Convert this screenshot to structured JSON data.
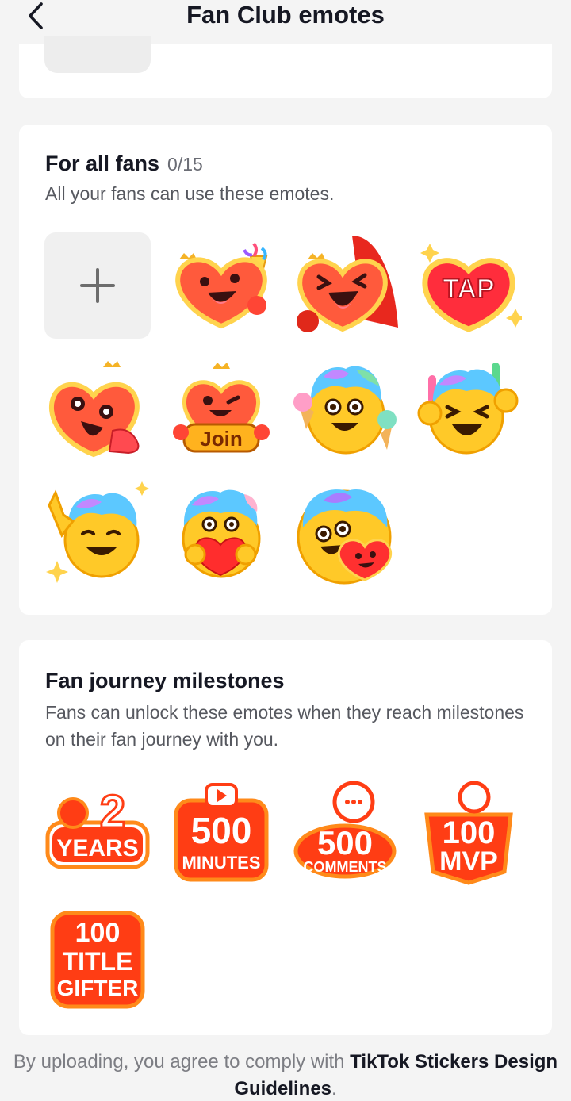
{
  "header": {
    "title": "Fan Club emotes"
  },
  "fans_section": {
    "title": "For all fans",
    "count": "0/15",
    "description": "All your fans can use these emotes.",
    "emotes": [
      {
        "icon": "heart-party-popper-emote"
      },
      {
        "icon": "heart-laughing-cape-emote"
      },
      {
        "icon": "tap-heart-emote",
        "text": "TAP"
      },
      {
        "icon": "heart-star-eyes-clapping-emote"
      },
      {
        "icon": "heart-join-wink-emote",
        "text": "Join"
      },
      {
        "icon": "rainbow-hair-ice-cream-emote"
      },
      {
        "icon": "rainbow-hair-cheering-emote"
      },
      {
        "icon": "rainbow-hair-pointing-emote"
      },
      {
        "icon": "rainbow-hair-heart-hug-emote"
      },
      {
        "icon": "rainbow-hair-with-heart-friend-emote"
      }
    ]
  },
  "milestones_section": {
    "title": "Fan journey milestones",
    "description": "Fans can unlock these emotes when they reach milestones on their fan journey with you.",
    "badges": [
      {
        "top": "2",
        "bottom": "YEARS"
      },
      {
        "top": "500",
        "bottom": "MINUTES"
      },
      {
        "top": "500",
        "bottom": "COMMENTS"
      },
      {
        "top": "100",
        "bottom": "MVP"
      },
      {
        "top": "100",
        "middle": "TITLE",
        "bottom": "GIFTER"
      }
    ]
  },
  "footer": {
    "text": "By uploading, you agree to comply with",
    "link": "TikTok Stickers Design Guidelines",
    "end": "."
  }
}
